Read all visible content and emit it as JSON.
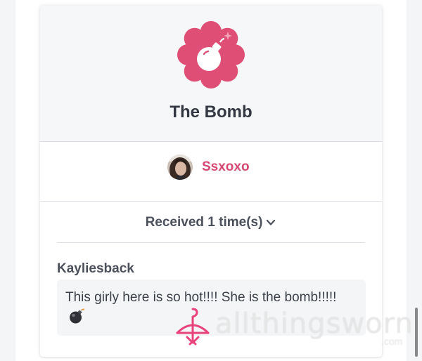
{
  "gift": {
    "title": "The Bomb",
    "badge_icon": "bomb-icon",
    "badge_color": "#df4e74"
  },
  "sender": {
    "name": "Ssxoxo",
    "name_color": "#d64973"
  },
  "received": {
    "label": "Received 1 time(s)",
    "expand_icon": "chevron-down-icon"
  },
  "comment": {
    "author": "Kayliesback",
    "text": "This girly here is so hot!!!! She is the bomb!!!!!",
    "emoji": "bomb-emoji"
  },
  "watermark": {
    "text": "allthingsworn",
    "suffix": ".com",
    "icon": "hanger-icon"
  }
}
